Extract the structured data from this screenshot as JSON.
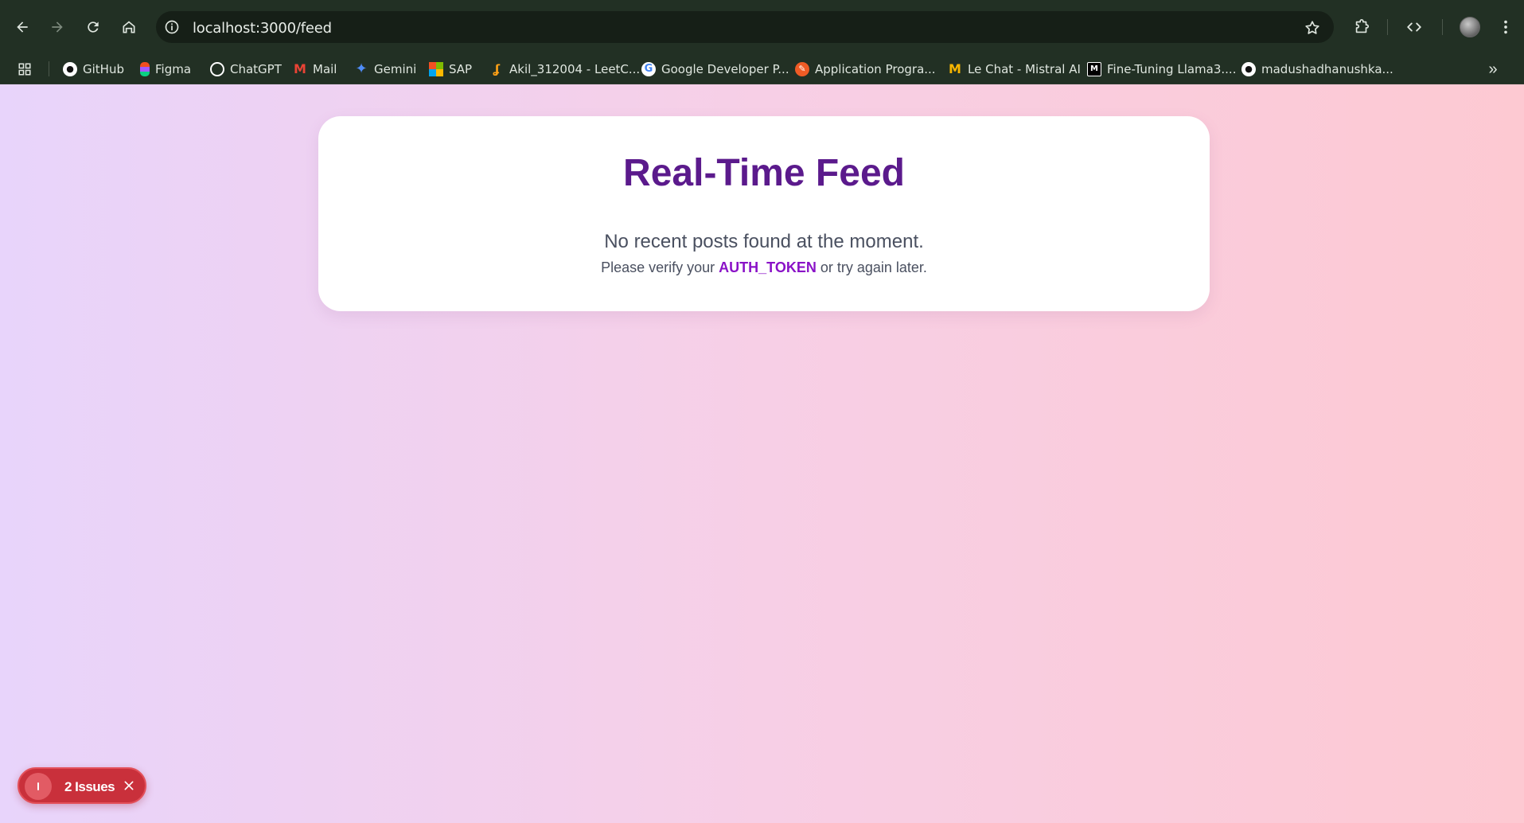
{
  "browser": {
    "url": "localhost:3000/feed",
    "bookmarks": [
      {
        "label": "GitHub",
        "icon": "github-icon",
        "color": "#ffffff"
      },
      {
        "label": "Figma",
        "icon": "figma-icon",
        "color": "#f24e1e"
      },
      {
        "label": "ChatGPT",
        "icon": "chatgpt-icon",
        "color": "#ffffff"
      },
      {
        "label": "Mail",
        "icon": "gmail-icon",
        "color": "#ea4335"
      },
      {
        "label": "Gemini",
        "icon": "gemini-icon",
        "color": "#4f8cf7"
      },
      {
        "label": "SAP",
        "icon": "microsoft-icon",
        "color": "#f25022"
      },
      {
        "label": "Akil_312004 - LeetC...",
        "icon": "leetcode-icon",
        "color": "#ffa116"
      },
      {
        "label": "Google Developer P...",
        "icon": "google-icon",
        "color": "#ffffff"
      },
      {
        "label": "Application Progra...",
        "icon": "postman-icon",
        "color": "#ef5b25"
      },
      {
        "label": "Le Chat - Mistral AI",
        "icon": "mistral-icon",
        "color": "#f7b500"
      },
      {
        "label": "Fine-Tuning Llama3....",
        "icon": "medium-icon",
        "color": "#000000"
      },
      {
        "label": "madushadhanushka...",
        "icon": "github-icon",
        "color": "#ffffff"
      }
    ]
  },
  "page": {
    "title": "Real-Time Feed",
    "message": "No recent posts found at the moment.",
    "sub_prefix": "Please verify your ",
    "sub_token": "AUTH_TOKEN",
    "sub_suffix": " or try again later."
  },
  "issues_badge": {
    "label": "2 Issues"
  }
}
